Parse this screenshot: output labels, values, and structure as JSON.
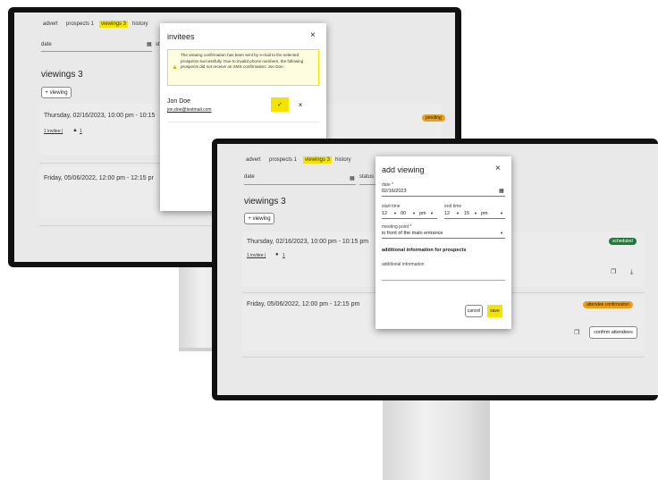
{
  "colors": {
    "accent": "#f2e400",
    "scheduled": "#1f7a3a",
    "attendee_confirmation": "#e89f1a",
    "pending": "#e89f1a"
  },
  "back": {
    "tabs": [
      {
        "label": "advert"
      },
      {
        "label": "prospects 1"
      },
      {
        "label": "viewings 3",
        "active": true
      },
      {
        "label": "history"
      }
    ],
    "filter_date_label": "date",
    "filter_status_label": "st",
    "page_title": "viewings 3",
    "add_viewing_label": "+ viewing",
    "card1": {
      "date": "Thursday, 02/16/2023, 10:00 pm - 10:15",
      "invitee_link": "1 invitee |",
      "count": "1",
      "status": "pending"
    },
    "card2": {
      "date": "Friday, 05/06/2022, 12:00 pm - 12:15 pr"
    },
    "dialog": {
      "title": "invitees",
      "close": "×",
      "alert_icon": "warning-icon",
      "alert_text": "The viewing confirmation has been sent by e-mail to the selected prospects successfully. Due to invalid phone numbers, the following prospects did not receive an SMS confirmation: Jon Doe .",
      "person_name": "Jon Doe",
      "person_email": "jon.doe@testmail.com",
      "check": "✓",
      "remove": "×"
    }
  },
  "front": {
    "tabs": [
      {
        "label": "advert"
      },
      {
        "label": "prospects 1"
      },
      {
        "label": "viewings 3",
        "active": true
      },
      {
        "label": "history"
      }
    ],
    "filter_date_label": "date",
    "filter_status_label": "status",
    "page_title": "viewings 3",
    "add_viewing_label": "+ viewing",
    "card1": {
      "date": "Thursday, 02/16/2023, 10:00 pm - 10:15 pm",
      "invitee_link": "1 invitee |",
      "count": "1",
      "status": "scheduled"
    },
    "card2": {
      "date": "Friday, 05/06/2022, 12:00 pm - 12:15 pm",
      "status": "attendee confirmation",
      "confirm_label": "confirm attendees"
    },
    "dialog": {
      "title": "add viewing",
      "close": "×",
      "date_label": "date *",
      "date_value": "02/16/2023",
      "start_label": "start time",
      "end_label": "end time",
      "start": {
        "hour": "12",
        "minute": "00",
        "ampm": "pm"
      },
      "end": {
        "hour": "12",
        "minute": "15",
        "ampm": "pm"
      },
      "meeting_label": "meeting point *",
      "meeting_value": "in front of the main entrance",
      "section_title": "additional information for prospects",
      "info_label": "additional information",
      "cancel_label": "cancel",
      "save_label": "save"
    }
  }
}
